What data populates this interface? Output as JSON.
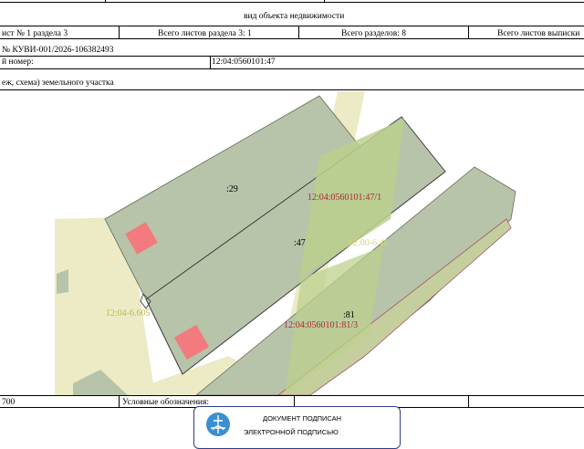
{
  "header": {
    "title": "вид объекта недвижимости",
    "sheet_of_section": "ист № 1 раздела 3",
    "total_sheets_section": "Всего листов раздела 3: 1",
    "total_sections": "Всего разделов: 8",
    "total_sheets_extract": "Всего листов выписки"
  },
  "registration": {
    "number_label": "№ КУВИ-001/2026-106382493",
    "cadastral_label": "й номер:",
    "cadastral_value": "12:04:0560101:47"
  },
  "plan_caption": "еж, схема) земельного участка",
  "map_labels": {
    "parcel_29": ":29",
    "parcel_47": ":47",
    "parcel_81": ":81",
    "label_471": "12:04:0560101:47/1",
    "label_646": "12:00-6.46",
    "label_605": "12:04-6.605",
    "label_813": "12:04:0560101:81/3"
  },
  "footer": {
    "scale_fragment": "700",
    "legend_label": "Условные обозначения:"
  },
  "stamp": {
    "line1": "ДОКУМЕНТ ПОДПИСАН",
    "line2": "ЭЛЕКТРОННОЙ ПОДПИСЬЮ"
  },
  "colors": {
    "parcel_fill": "#b7c4a9",
    "highlight_fill": "#bcd08e",
    "road_fill": "#ecebc6",
    "building_fill": "#f37a7e",
    "label_red": "#b0233b",
    "label_yellow": "#d8d27a",
    "stamp_border": "#2a3f8c"
  }
}
